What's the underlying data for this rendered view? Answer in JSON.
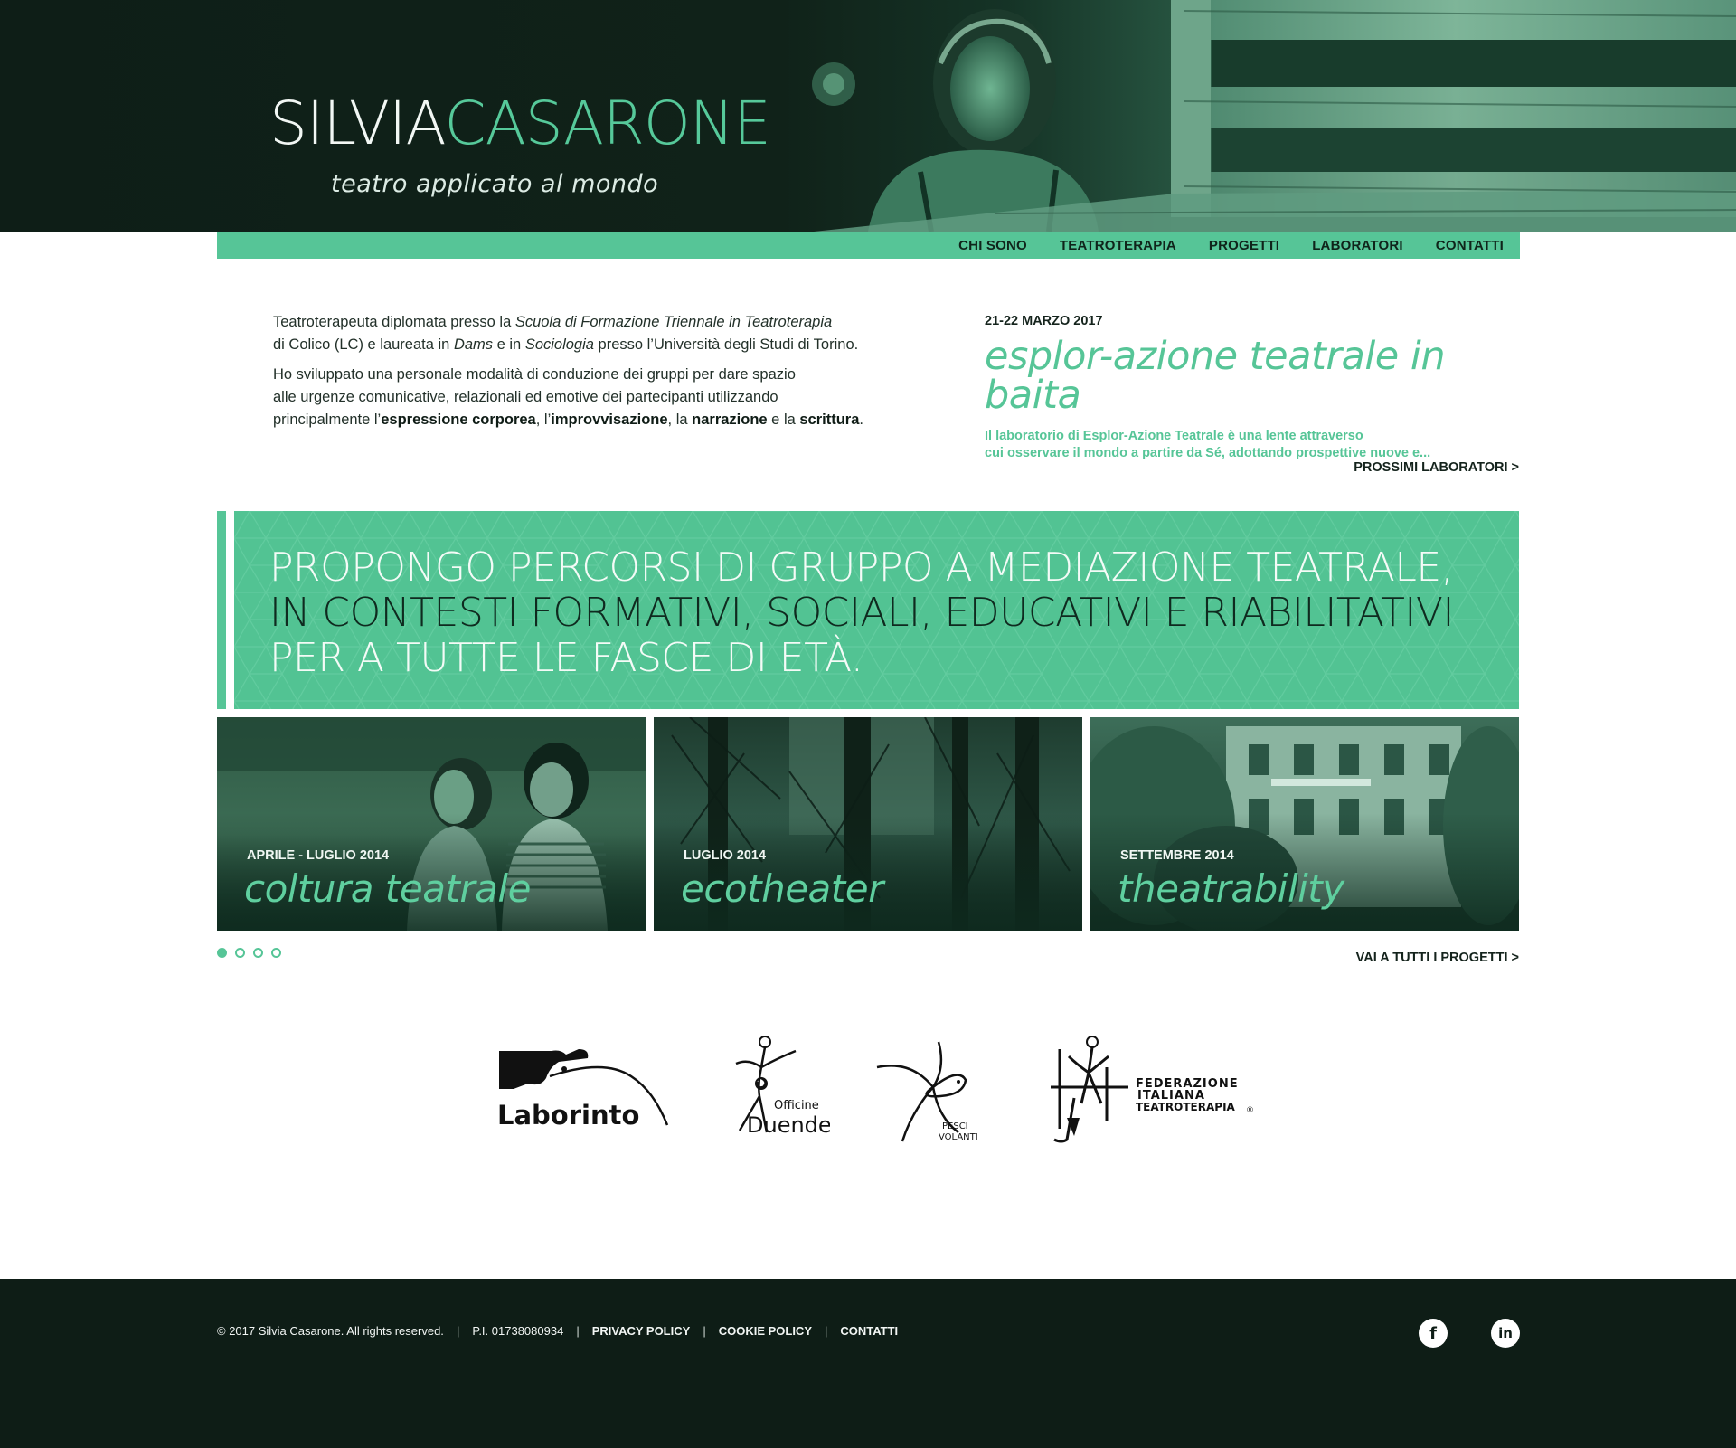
{
  "brand": {
    "first": "SILVIA",
    "last": "CASARONE",
    "tagline": "teatro applicato al mondo"
  },
  "nav": {
    "items": [
      "CHI SONO",
      "TEATROTERAPIA",
      "PROGETTI",
      "LABORATORI",
      "CONTATTI"
    ]
  },
  "intro": {
    "p1_a": "Teatroterapeuta diplomata presso la ",
    "p1_em1": "Scuola di Formazione Triennale in Teatroterapia",
    "p1_b": "di Colico (LC) e laureata in ",
    "p1_em2": "Dams",
    "p1_c": " e in ",
    "p1_em3": "Sociologia",
    "p1_d": " presso l’Università degli Studi di Torino.",
    "p2_a": "Ho sviluppato una personale modalità di conduzione dei gruppi per dare spazio",
    "p2_b": "alle urgenze comunicative, relazionali ed emotive dei partecipanti utilizzando",
    "p2_c": "principalmente l’",
    "p2_b1": "espressione corporea",
    "p2_d": ", l’",
    "p2_b2": "improvvisazione",
    "p2_e": ", la ",
    "p2_b3": "narrazione",
    "p2_f": " e la ",
    "p2_b4": "scrittura",
    "p2_g": "."
  },
  "event": {
    "date": "21-22 MARZO 2017",
    "title": "esplor-azione teatrale in baita",
    "desc1": "Il laboratorio di Esplor-Azione Teatrale è una lente attraverso",
    "desc2": "cui osservare il mondo a partire da Sé, adottando prospettive nuove e..."
  },
  "more_link": "PROSSIMI LABORATORI >",
  "banner": {
    "line1": "PROPONGO PERCORSI DI GRUPPO A MEDIAZIONE TEATRALE,",
    "line2": "IN CONTESTI FORMATIVI, SOCIALI, EDUCATIVI E RIABILITATIVI",
    "line3": "PER A TUTTE LE FASCE DI ETÀ."
  },
  "projects": [
    {
      "date": "APRILE - LUGLIO 2014",
      "title": "coltura teatrale"
    },
    {
      "date": "LUGLIO 2014",
      "title": "ecotheater"
    },
    {
      "date": "SETTEMBRE 2014",
      "title": "theatrability"
    }
  ],
  "slider": {
    "count": 4,
    "active": 1
  },
  "all_link": "VAI A TUTTI I PROGETTI >",
  "partners": {
    "laborinto": "Laborinto",
    "officine_top": "Officine",
    "officine_bottom": "Duende",
    "pesci_1": "PESCI",
    "pesci_2": "VOLANTI",
    "fit_1": "FEDERAZIONE",
    "fit_2": "ITALIANA",
    "fit_3": "TEATROTERAPIA",
    "fit_reg": "®"
  },
  "footer": {
    "copyright": "© 2017 Silvia Casarone. All rights reserved.",
    "piva": "P.I. 01738080934",
    "privacy": "PRIVACY POLICY",
    "cookie": "COOKIE POLICY",
    "contatti": "CONTATTI",
    "sep": "|",
    "facebook": "f",
    "linkedin": "in"
  },
  "colors": {
    "accent": "#56c597",
    "dark": "#0e1d16",
    "banner": "#52c393"
  }
}
